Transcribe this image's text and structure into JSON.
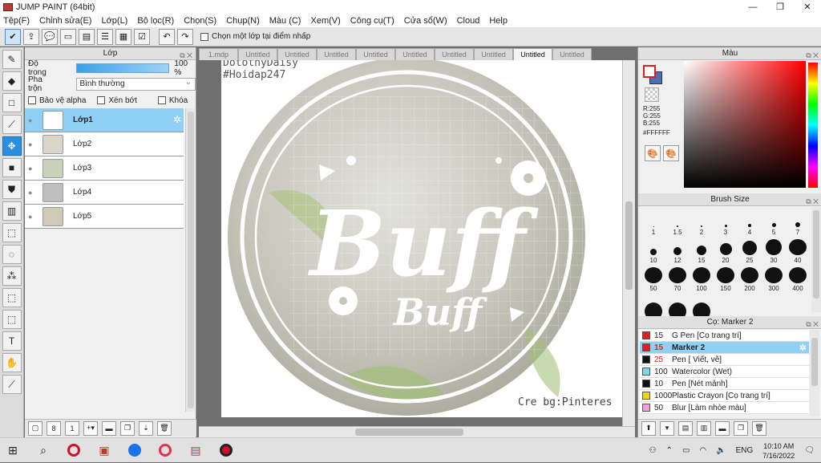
{
  "window": {
    "title": "JUMP PAINT (64bit)",
    "controls": [
      "—",
      "❐",
      "✕"
    ]
  },
  "menu": [
    "Tệp(F)",
    "Chỉnh sửa(E)",
    "Lớp(L)",
    "Bộ lọc(R)",
    "Chọn(S)",
    "Chụp(N)",
    "Màu (C)",
    "Xem(V)",
    "Công cụ(T)",
    "Cửa sổ(W)",
    "Cloud",
    "Help"
  ],
  "toolbar": {
    "option_label": "Chọn một lớp tại điểm nhấp"
  },
  "layer_panel": {
    "title": "Lớp",
    "opacity_label": "Độ trong",
    "opacity_value": "100 %",
    "opacity": 1.0,
    "blend_label": "Pha trộn",
    "blend_value": "Bình thường",
    "protect_alpha": "Bảo vệ alpha",
    "clipping": "Xén bớt",
    "lock": "Khóa",
    "layers": [
      {
        "name": "Lớp1",
        "selected": true
      },
      {
        "name": "Lớp2",
        "selected": false
      },
      {
        "name": "Lớp3",
        "selected": false
      },
      {
        "name": "Lớp4",
        "selected": false
      },
      {
        "name": "Lớp5",
        "selected": false
      }
    ]
  },
  "tabs": [
    {
      "label": "1.mdp",
      "active": false
    },
    {
      "label": "Untitled",
      "active": false
    },
    {
      "label": "Untitled",
      "active": false
    },
    {
      "label": "Untitled",
      "active": false
    },
    {
      "label": "Untitled",
      "active": false
    },
    {
      "label": "Untitled",
      "active": false
    },
    {
      "label": "Untitled",
      "active": false
    },
    {
      "label": "Untitled",
      "active": false
    },
    {
      "label": "Untitled",
      "active": true
    },
    {
      "label": "Untitled",
      "active": false
    }
  ],
  "canvas": {
    "watermark_line1": "DotothyDaisy",
    "watermark_line2": "#Hoidap247",
    "main_text": "Buff",
    "sub_text": "Buff",
    "credit": "Cre bg:Pinteres"
  },
  "color_panel": {
    "title": "Màu",
    "r": "R:255",
    "g": "G:255",
    "b": "B:255",
    "hex": "#FFFFFF"
  },
  "brush_panel": {
    "title": "Brush Size",
    "sizes": [
      "1",
      "1.5",
      "2",
      "3",
      "4",
      "5",
      "7",
      "10",
      "12",
      "15",
      "20",
      "25",
      "30",
      "40",
      "50",
      "70",
      "100",
      "150",
      "200",
      "300",
      "400",
      "",
      "",
      ""
    ]
  },
  "marker_panel": {
    "title": "Cọ: Marker 2",
    "items": [
      {
        "size": "15",
        "name": "G Pen [Cọ trang trí]",
        "color": "#e02020",
        "selected": false
      },
      {
        "size": "15",
        "name": "Marker 2",
        "color": "#e02020",
        "selected": true
      },
      {
        "size": "25",
        "name": "Pen [ Viết, vẽ]",
        "color": "#111111",
        "selected": false
      },
      {
        "size": "100",
        "name": "Watercolor (Wet)",
        "color": "#7fd6f0",
        "selected": false
      },
      {
        "size": "10",
        "name": "Pen [Nét mảnh]",
        "color": "#111111",
        "selected": false
      },
      {
        "size": "1000",
        "name": "Plastic Crayon [Cọ trang trí]",
        "color": "#f2d21a",
        "selected": false
      },
      {
        "size": "50",
        "name": "Blur [Làm nhòe màu]",
        "color": "#f0a0d8",
        "selected": false
      }
    ]
  },
  "taskbar": {
    "lang": "ENG",
    "time": "10:10 AM",
    "date": "7/16/2022"
  }
}
